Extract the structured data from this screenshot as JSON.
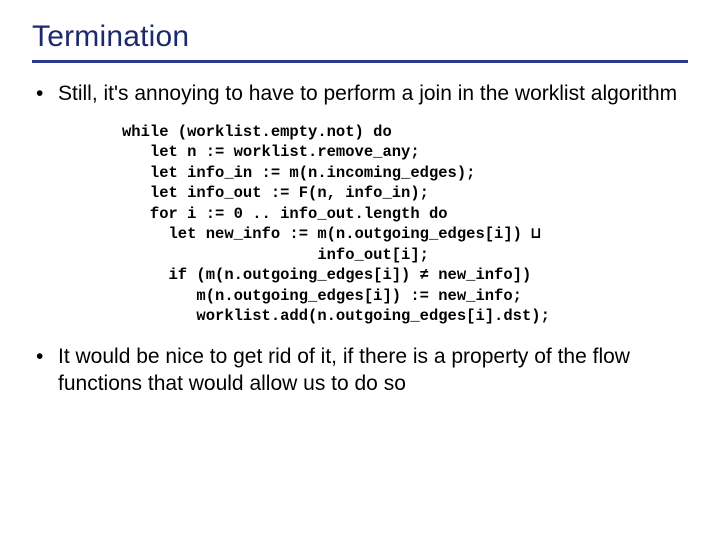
{
  "title": "Termination",
  "bullets": [
    "Still, it's annoying to have to perform a join in the worklist algorithm",
    "It would be nice to get rid of it, if there is a property of the flow functions that would allow us to do so"
  ],
  "code": "while (worklist.empty.not) do\n   let n := worklist.remove_any;\n   let info_in := m(n.incoming_edges);\n   let info_out := F(n, info_in);\n   for i := 0 .. info_out.length do\n     let new_info := m(n.outgoing_edges[i]) ⊔\n                     info_out[i];\n     if (m(n.outgoing_edges[i]) ≠ new_info])\n        m(n.outgoing_edges[i]) := new_info;\n        worklist.add(n.outgoing_edges[i].dst);"
}
